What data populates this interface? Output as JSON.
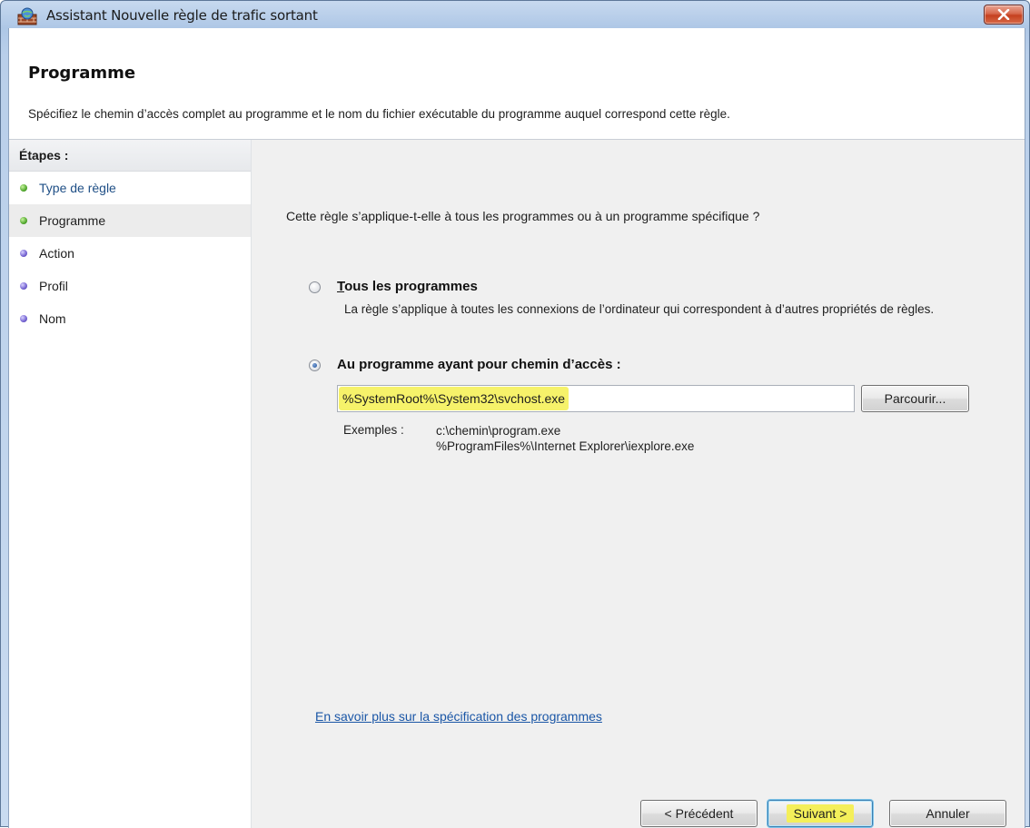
{
  "window": {
    "title": "Assistant Nouvelle règle de trafic sortant",
    "close_glyph": "✕"
  },
  "header": {
    "title": "Programme",
    "description": "Spécifiez le chemin d’accès complet au programme et le nom du fichier exécutable du programme auquel correspond cette règle."
  },
  "sidebar": {
    "heading": "Étapes :",
    "items": [
      {
        "label": "Type de règle",
        "status": "completed",
        "dot_color": "#52a82e"
      },
      {
        "label": "Programme",
        "status": "current",
        "dot_color": "#52a82e"
      },
      {
        "label": "Action",
        "status": "pending",
        "dot_color": "#7362d1"
      },
      {
        "label": "Profil",
        "status": "pending",
        "dot_color": "#7362d1"
      },
      {
        "label": "Nom",
        "status": "pending",
        "dot_color": "#7362d1"
      }
    ]
  },
  "main": {
    "question": "Cette règle s’applique-t-elle à tous les programmes ou à un programme spécifique ?",
    "option_all": {
      "label": "Tous les programmes",
      "checked": false,
      "description": "La règle s’applique à toutes les connexions de l’ordinateur qui correspondent à d’autres propriétés de règles."
    },
    "option_path": {
      "label": "Au programme ayant pour chemin d’accès :",
      "checked": true,
      "value": "%SystemRoot%\\System32\\svchost.exe"
    },
    "browse_label": "Parcourir...",
    "examples_label": "Exemples :",
    "examples": [
      "c:\\chemin\\program.exe",
      "%ProgramFiles%\\Internet Explorer\\iexplore.exe"
    ],
    "learn_more": "En savoir plus sur la spécification des programmes"
  },
  "footer": {
    "back_label": "< Précédent",
    "next_label": "Suivant >",
    "cancel_label": "Annuler"
  },
  "colors": {
    "accent_link": "#1a56a6",
    "highlight": "#f6f26a",
    "title_bar": "#aec7e6"
  }
}
